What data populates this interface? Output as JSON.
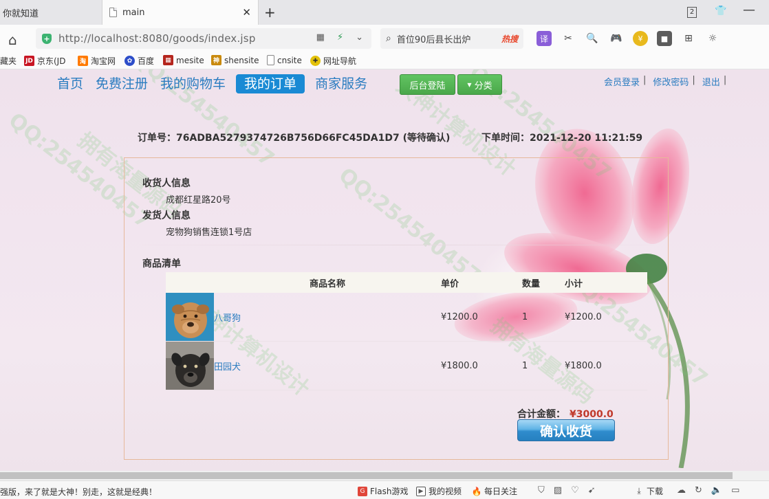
{
  "browser": {
    "tabs": [
      {
        "label": "你就知道",
        "active": false
      },
      {
        "label": "main",
        "active": true
      }
    ],
    "window_badge": "2",
    "url": "http://localhost:8080/goods/index.jsp",
    "search_text": "首位90后县长出炉",
    "search_badge": "热搜",
    "translate_badge": "译",
    "bookmarks": [
      "藏夹",
      "京东(JD",
      "淘宝网",
      "百度",
      "mesite",
      "shensite",
      "cnsite",
      "网址导航"
    ],
    "status_text": "强版，来了就是大神！别走，这就是经典！",
    "status_items": [
      "Flash游戏",
      "我的视频",
      "每日关注",
      "下载"
    ]
  },
  "site": {
    "nav": [
      "首页",
      "免费注册",
      "我的购物车",
      "我的订单",
      "商家服务"
    ],
    "active_nav": 3,
    "admin_login": "后台登陆",
    "category": "分类",
    "member_login": "会员登录",
    "change_password": "修改密码",
    "logout": "退出",
    "separator": "|"
  },
  "order": {
    "number_label": "订单号：76ADBA5279374726B756D66FC45DA1D7 (等待确认)",
    "time_label": "下单时间：2021-12-20 11:21:59",
    "receiver_title": "收货人信息",
    "receiver_address": "成都红星路20号",
    "sender_title": "发货人信息",
    "sender_address": "宠物狗销售连锁1号店",
    "goods_title": "商品清单",
    "columns": [
      "商品名称",
      "单价",
      "数量",
      "小计"
    ],
    "items": [
      {
        "name": "八哥狗",
        "price": "¥1200.0",
        "qty": "1",
        "subtotal": "¥1200.0"
      },
      {
        "name": "田园犬",
        "price": "¥1800.0",
        "qty": "1",
        "subtotal": "¥1800.0"
      }
    ],
    "total_label": "合计金额：",
    "total_value": "¥3000.0",
    "confirm_button": "确认收货"
  },
  "watermarks": [
    "QQ:254540457",
    "拥有海量源码",
    "大神计算机设计"
  ],
  "colors": {
    "link": "#2a7cc0",
    "active_nav": "#1a8ad4",
    "green_button": "#4aa84a",
    "total_amount": "#c0392b",
    "box_border": "#e6b89a"
  }
}
